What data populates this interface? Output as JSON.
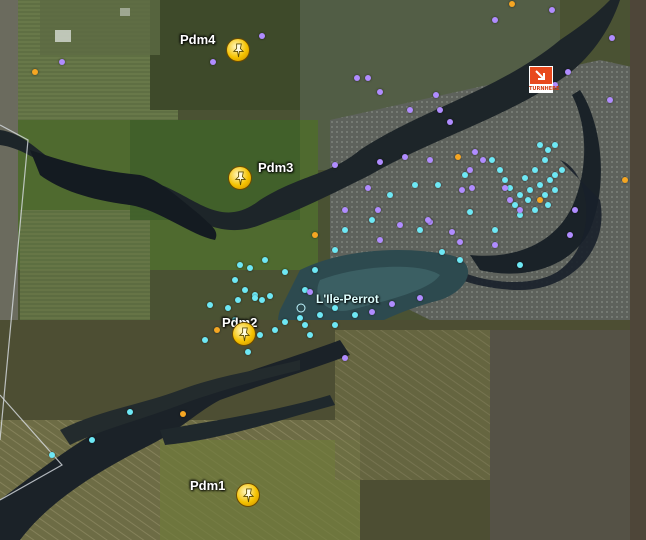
{
  "colors": {
    "cyan_marker": "#6ee8f5",
    "purple_marker": "#b08cff",
    "orange_marker": "#f5a623",
    "placemark": "#f5c200"
  },
  "placemarks": [
    {
      "label": "Pdm4",
      "icon": "pushpin-icon"
    },
    {
      "label": "Pdm3",
      "icon": "pushpin-icon"
    },
    {
      "label": "Pdm2",
      "icon": "pushpin-icon"
    },
    {
      "label": "Pdm1",
      "icon": "pushpin-icon"
    }
  ],
  "place_label": "L'Ile-Perrot",
  "turn_here_label": "TURNHERE"
}
